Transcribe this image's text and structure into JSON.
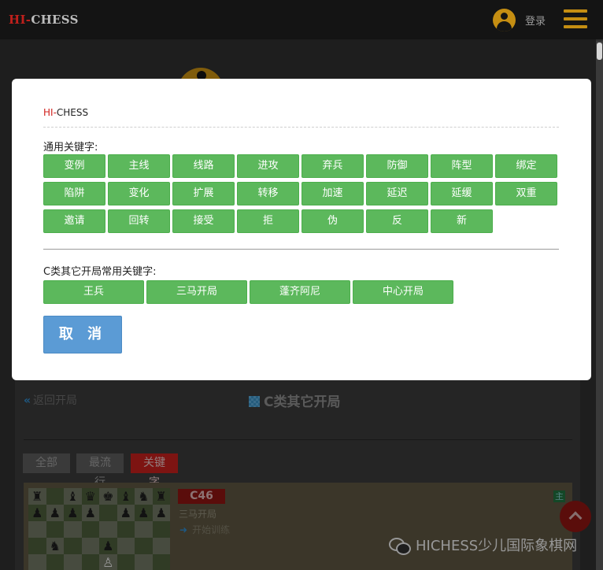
{
  "header": {
    "logo_hi": "HI-",
    "logo_chess": "CHESS",
    "login_label": "登录"
  },
  "background_page": {
    "back_label": "返回开局",
    "back_icon": "double-chevron-left-icon",
    "section_icon": "grid-icon",
    "section_title": "C类其它开局",
    "filters": {
      "all": "全部",
      "popular": "最流行",
      "keyword": "关键字"
    },
    "card": {
      "code": "C46",
      "name": "三马开局",
      "train_label": "开始训练",
      "tag": "主"
    },
    "watermark": "HICHESS少儿国际象棋网"
  },
  "modal": {
    "title_hi": "HI-",
    "title_rest": "CHESS",
    "general_label": "通用关键字:",
    "general_keywords": [
      "变例",
      "主线",
      "线路",
      "进攻",
      "弃兵",
      "防御",
      "阵型",
      "绑定",
      "陷阱",
      "变化",
      "扩展",
      "转移",
      "加速",
      "延迟",
      "延缓",
      "双重",
      "邀请",
      "回转",
      "接受",
      "拒",
      "伪",
      "反",
      "新"
    ],
    "specific_label": "C类其它开局常用关键字:",
    "specific_keywords": [
      "王兵",
      "三马开局",
      "蓬齐阿尼",
      "中心开局"
    ],
    "cancel_label": "取 消"
  },
  "colors": {
    "keyword_button": "#5cb85c",
    "cancel_button": "#5b9bd5",
    "accent_red": "#c0201c",
    "accent_gold": "#c58e12"
  }
}
